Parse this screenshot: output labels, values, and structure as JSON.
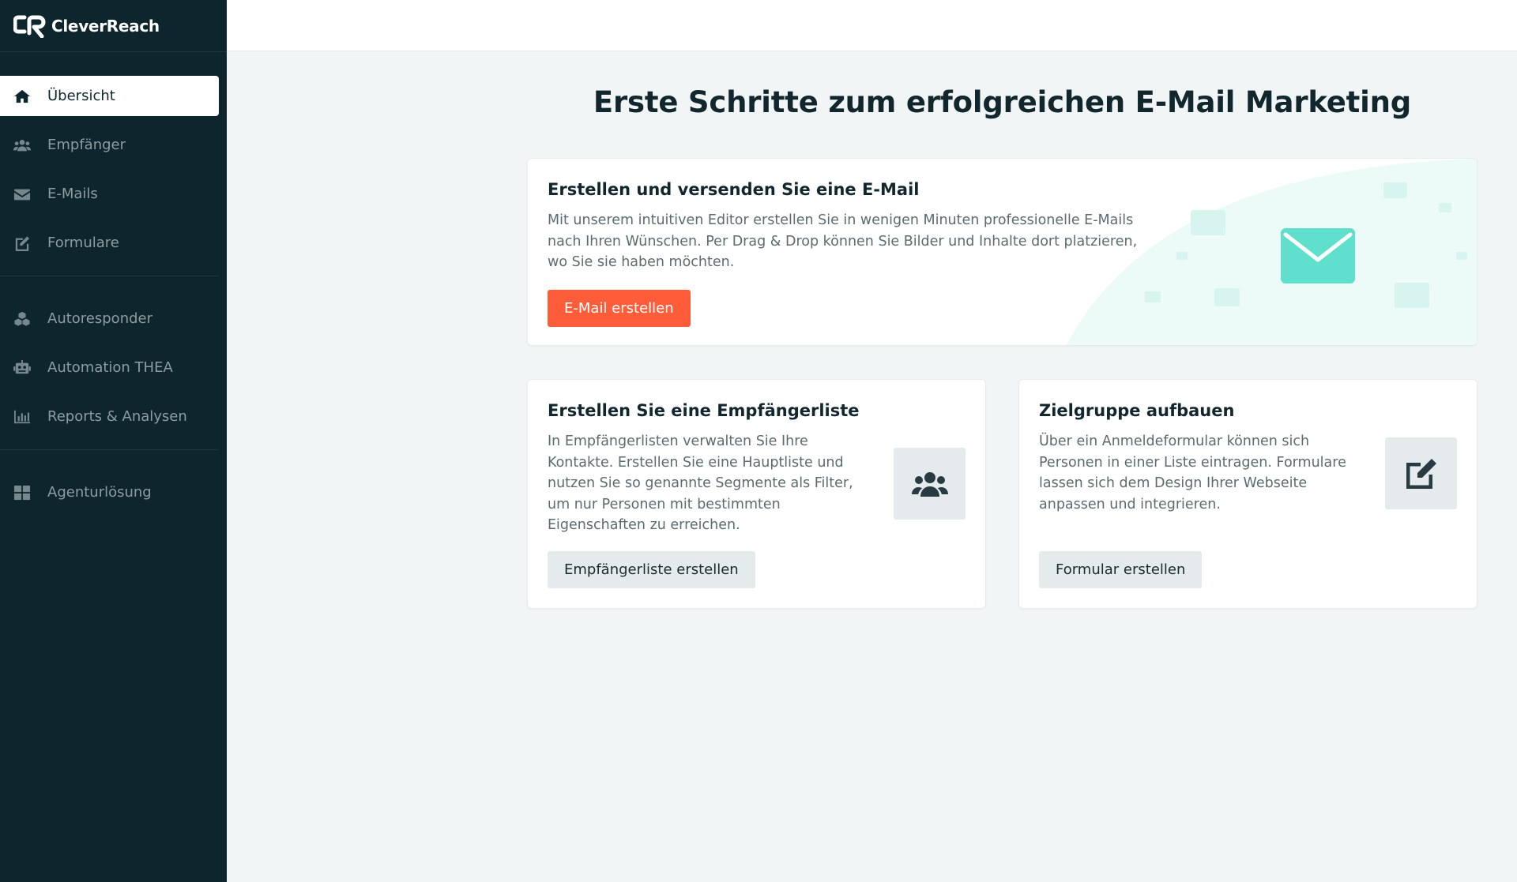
{
  "brand": {
    "name": "CleverReach"
  },
  "sidebar": {
    "group1": [
      {
        "label": "Übersicht",
        "icon": "home-icon",
        "active": true
      },
      {
        "label": "Empfänger",
        "icon": "users-icon"
      },
      {
        "label": "E-Mails",
        "icon": "envelope-icon"
      },
      {
        "label": "Formulare",
        "icon": "edit-icon"
      }
    ],
    "group2": [
      {
        "label": "Autoresponder",
        "icon": "cubes-icon"
      },
      {
        "label": "Automation THEA",
        "icon": "robot-icon"
      },
      {
        "label": "Reports & Analysen",
        "icon": "chart-icon"
      }
    ],
    "group3": [
      {
        "label": "Agenturlösung",
        "icon": "grid-icon"
      }
    ]
  },
  "main": {
    "headline": "Erste Schritte zum erfolgreichen E-Mail Marketing",
    "email_card": {
      "title": "Erstellen und versenden Sie eine E-Mail",
      "text": "Mit unserem intuitiven Editor erstellen Sie in wenigen Minuten professionelle E-Mails nach Ihren Wünschen. Per Drag & Drop können Sie Bilder und Inhalte dort platzieren, wo Sie sie haben möchten.",
      "button": "E-Mail erstellen",
      "icon": "envelope-icon"
    },
    "list_card": {
      "title": "Erstellen Sie eine Empfängerliste",
      "text": "In Empfängerlisten verwalten Sie Ihre Kontakte. Erstellen Sie eine Hauptliste und nutzen Sie so genannte Segmente als Filter, um nur Personen mit bestimmten Eigenschaften zu erreichen.",
      "button": "Empfängerliste erstellen",
      "icon": "users-icon"
    },
    "form_card": {
      "title": "Zielgruppe aufbauen",
      "text": "Über ein Anmeldeformular können sich Personen in einer Liste eintragen. Formulare lassen sich dem Design Ihrer Webseite anpassen und integrieren.",
      "button": "Formular erstellen",
      "icon": "edit-icon"
    }
  },
  "colors": {
    "sidebar_bg": "#0d252c",
    "primary_button": "#ff5c3a",
    "accent_mint": "#5fe0cc",
    "page_bg": "#f1f5f6"
  }
}
